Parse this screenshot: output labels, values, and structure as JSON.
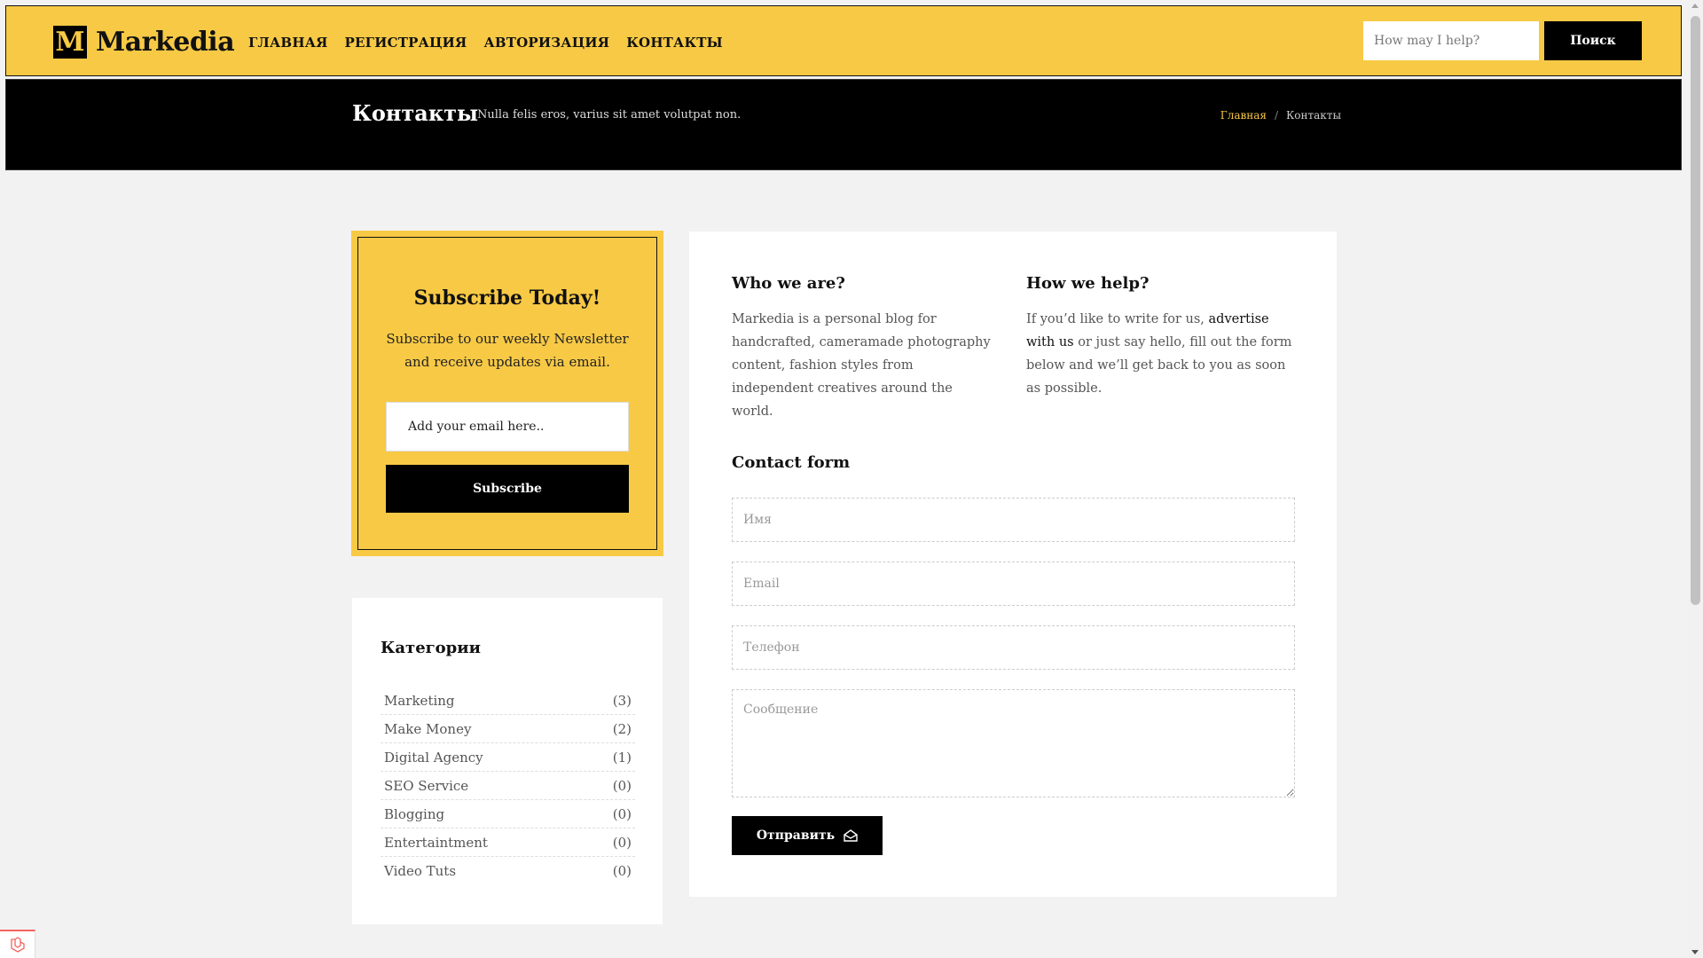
{
  "brand": {
    "mark": "M",
    "name": "Markedia",
    "accent": "#f7c945"
  },
  "nav": {
    "items": [
      "ГЛАВНАЯ",
      "РЕГИСТРАЦИЯ",
      "АВТОРИЗАЦИЯ",
      "КОНТАКТЫ"
    ]
  },
  "search": {
    "placeholder": "How may I help?",
    "button": "Поиск"
  },
  "page_header": {
    "title": "Контакты",
    "subtitle": "Nulla felis eros, varius sit amet volutpat non.",
    "breadcrumb": {
      "home": "Главная",
      "separator": "/",
      "current": "Контакты"
    }
  },
  "subscribe": {
    "title": "Subscribe Today!",
    "text": "Subscribe to our weekly Newsletter and receive updates via email.",
    "placeholder": "Add your email here..",
    "button": "Subscribe"
  },
  "categories": {
    "title": "Категории",
    "items": [
      {
        "name": "Marketing",
        "count": "(3)"
      },
      {
        "name": "Make Money",
        "count": "(2)"
      },
      {
        "name": "Digital Agency",
        "count": "(1)"
      },
      {
        "name": "SEO Service",
        "count": "(0)"
      },
      {
        "name": "Blogging",
        "count": "(0)"
      },
      {
        "name": "Entertaintment",
        "count": "(0)"
      },
      {
        "name": "Video Tuts",
        "count": "(0)"
      }
    ]
  },
  "about": {
    "who_title": "Who we are?",
    "who_text": "Markedia is a personal blog for handcrafted, cameramade photography content, fashion styles from independent creatives around the world.",
    "how_title": "How we help?",
    "how_text_1": "If you’d like to write for us, ",
    "how_link": "advertise with us",
    "how_text_2": " or just say hello, fill out the form below and we’ll get back to you as soon as possible."
  },
  "contact_form": {
    "title": "Contact form",
    "name_placeholder": "Имя",
    "email_placeholder": "Email",
    "phone_placeholder": "Телефон",
    "message_placeholder": "Сообщение",
    "submit": "Отправить",
    "submit_icon": "envelope-open-icon"
  }
}
